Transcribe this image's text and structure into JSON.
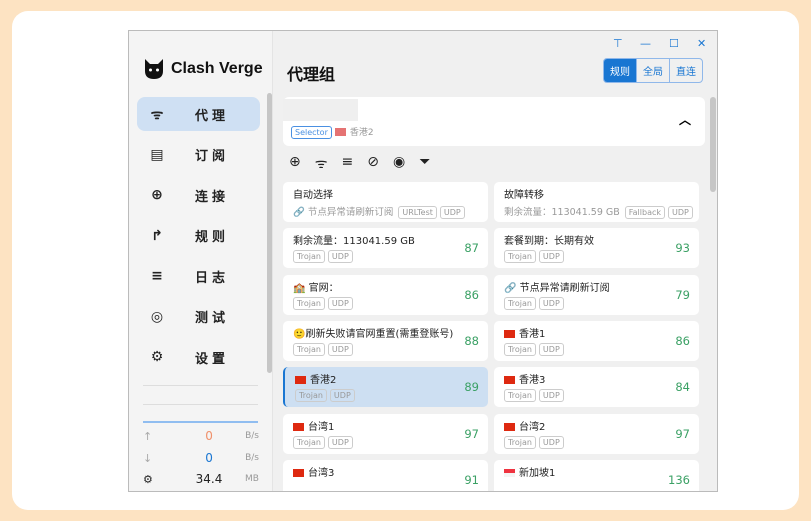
{
  "app": {
    "name": "Clash Verge"
  },
  "sidebar": {
    "items": [
      {
        "label": "代理",
        "icon": "wifi-icon",
        "selected": true
      },
      {
        "label": "订阅",
        "icon": "server-icon"
      },
      {
        "label": "连接",
        "icon": "globe-icon"
      },
      {
        "label": "规则",
        "icon": "rule-icon"
      },
      {
        "label": "日志",
        "icon": "list-icon"
      },
      {
        "label": "测试",
        "icon": "radar-icon"
      },
      {
        "label": "设置",
        "icon": "gear-icon"
      }
    ],
    "traffic": {
      "up": "0",
      "up_unit": "B/s",
      "down": "0",
      "down_unit": "B/s",
      "memory": "34.4",
      "memory_unit": "MB"
    }
  },
  "header": {
    "title": "代理组",
    "modes": [
      "规则",
      "全局",
      "直连"
    ],
    "active_mode": "规则"
  },
  "group": {
    "type": "Selector",
    "current": "香港2"
  },
  "proxies": [
    {
      "name": "自动选择",
      "sub": "🔗 节点异常请刷新订阅",
      "tags": [
        "URLTest",
        "UDP"
      ],
      "delay": ""
    },
    {
      "name": "故障转移",
      "sub": "剩余流量：113041.59 GB",
      "tags": [
        "Fallback",
        "UDP"
      ],
      "delay": ""
    },
    {
      "name": "剩余流量：113041.59 GB",
      "tags": [
        "Trojan",
        "UDP"
      ],
      "delay": "87"
    },
    {
      "name": "套餐到期：长期有效",
      "tags": [
        "Trojan",
        "UDP"
      ],
      "delay": "93"
    },
    {
      "name": "🏫 官网：",
      "tags": [
        "Trojan",
        "UDP"
      ],
      "delay": "86"
    },
    {
      "name": "🔗 节点异常请刷新订阅",
      "tags": [
        "Trojan",
        "UDP"
      ],
      "delay": "79"
    },
    {
      "name": "🙂刷新失败请官网重置(需重登账号)",
      "tags": [
        "Trojan",
        "UDP"
      ],
      "delay": "88"
    },
    {
      "name": "香港1",
      "flag": "hk",
      "tags": [
        "Trojan",
        "UDP"
      ],
      "delay": "86"
    },
    {
      "name": "香港2",
      "flag": "hk",
      "tags": [
        "Trojan",
        "UDP"
      ],
      "delay": "89",
      "selected": true
    },
    {
      "name": "香港3",
      "flag": "hk",
      "tags": [
        "Trojan",
        "UDP"
      ],
      "delay": "84"
    },
    {
      "name": "台湾1",
      "flag": "cn",
      "tags": [
        "Trojan",
        "UDP"
      ],
      "delay": "97"
    },
    {
      "name": "台湾2",
      "flag": "cn",
      "tags": [
        "Trojan",
        "UDP"
      ],
      "delay": "97"
    },
    {
      "name": "台湾3",
      "flag": "cn",
      "tags": [],
      "delay": "91"
    },
    {
      "name": "新加坡1",
      "flag": "sg",
      "tags": [],
      "delay": "136"
    }
  ],
  "colors": {
    "accent": "#1976d2",
    "delay": "#3aa064",
    "highlight": "#f03a17",
    "upload": "#f0906a"
  }
}
